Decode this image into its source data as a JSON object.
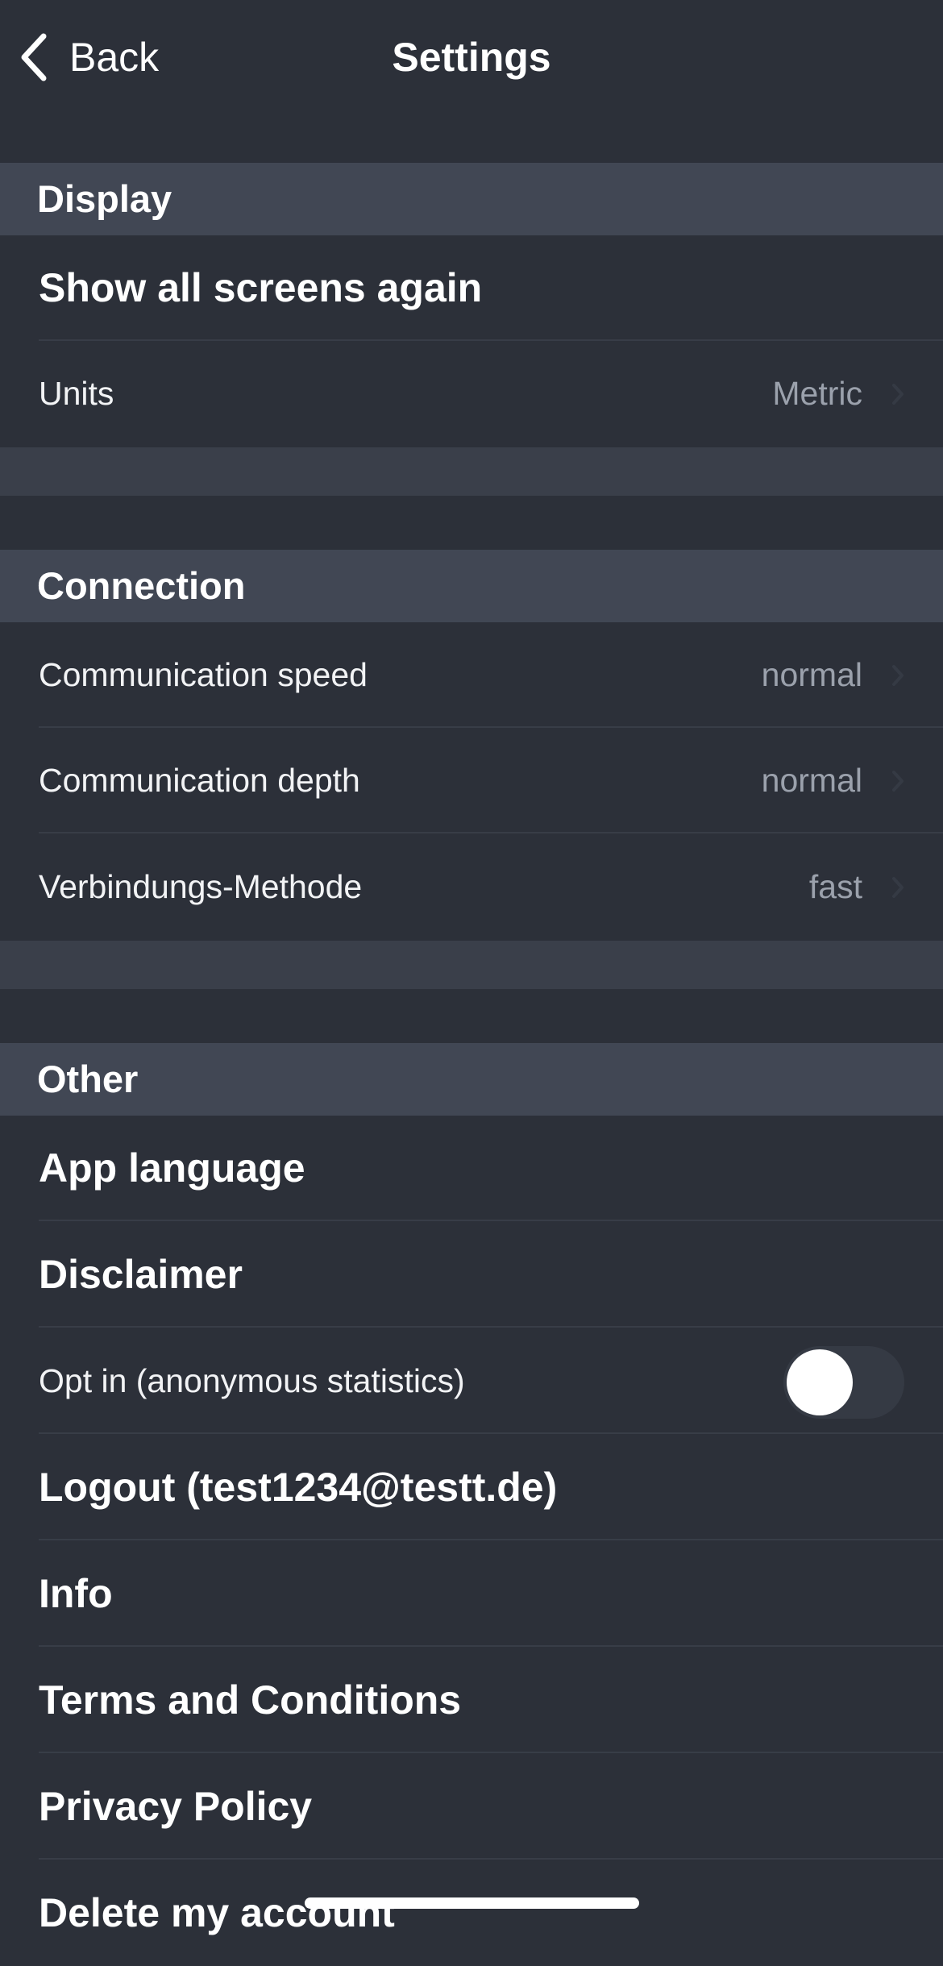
{
  "nav": {
    "back_label": "Back",
    "title": "Settings"
  },
  "sections": {
    "display": {
      "title": "Display",
      "show_all_screens": "Show all screens again",
      "units_label": "Units",
      "units_value": "Metric"
    },
    "connection": {
      "title": "Connection",
      "speed_label": "Communication speed",
      "speed_value": "normal",
      "depth_label": "Communication depth",
      "depth_value": "normal",
      "method_label": "Verbindungs-Methode",
      "method_value": "fast"
    },
    "other": {
      "title": "Other",
      "app_language": "App language",
      "disclaimer": "Disclaimer",
      "opt_in_label": "Opt in (anonymous statistics)",
      "opt_in_enabled": false,
      "logout": "Logout (test1234@testt.de)",
      "info": "Info",
      "terms": "Terms and Conditions",
      "privacy": "Privacy Policy",
      "delete_account": "Delete my account"
    }
  },
  "colors": {
    "background": "#2c3039",
    "section_header": "#414754",
    "spacer": "#3a3f4a",
    "secondary_text": "#9ba1ac"
  },
  "icons": {
    "back": "chevron-left-icon",
    "disclosure": "chevron-right-icon"
  }
}
